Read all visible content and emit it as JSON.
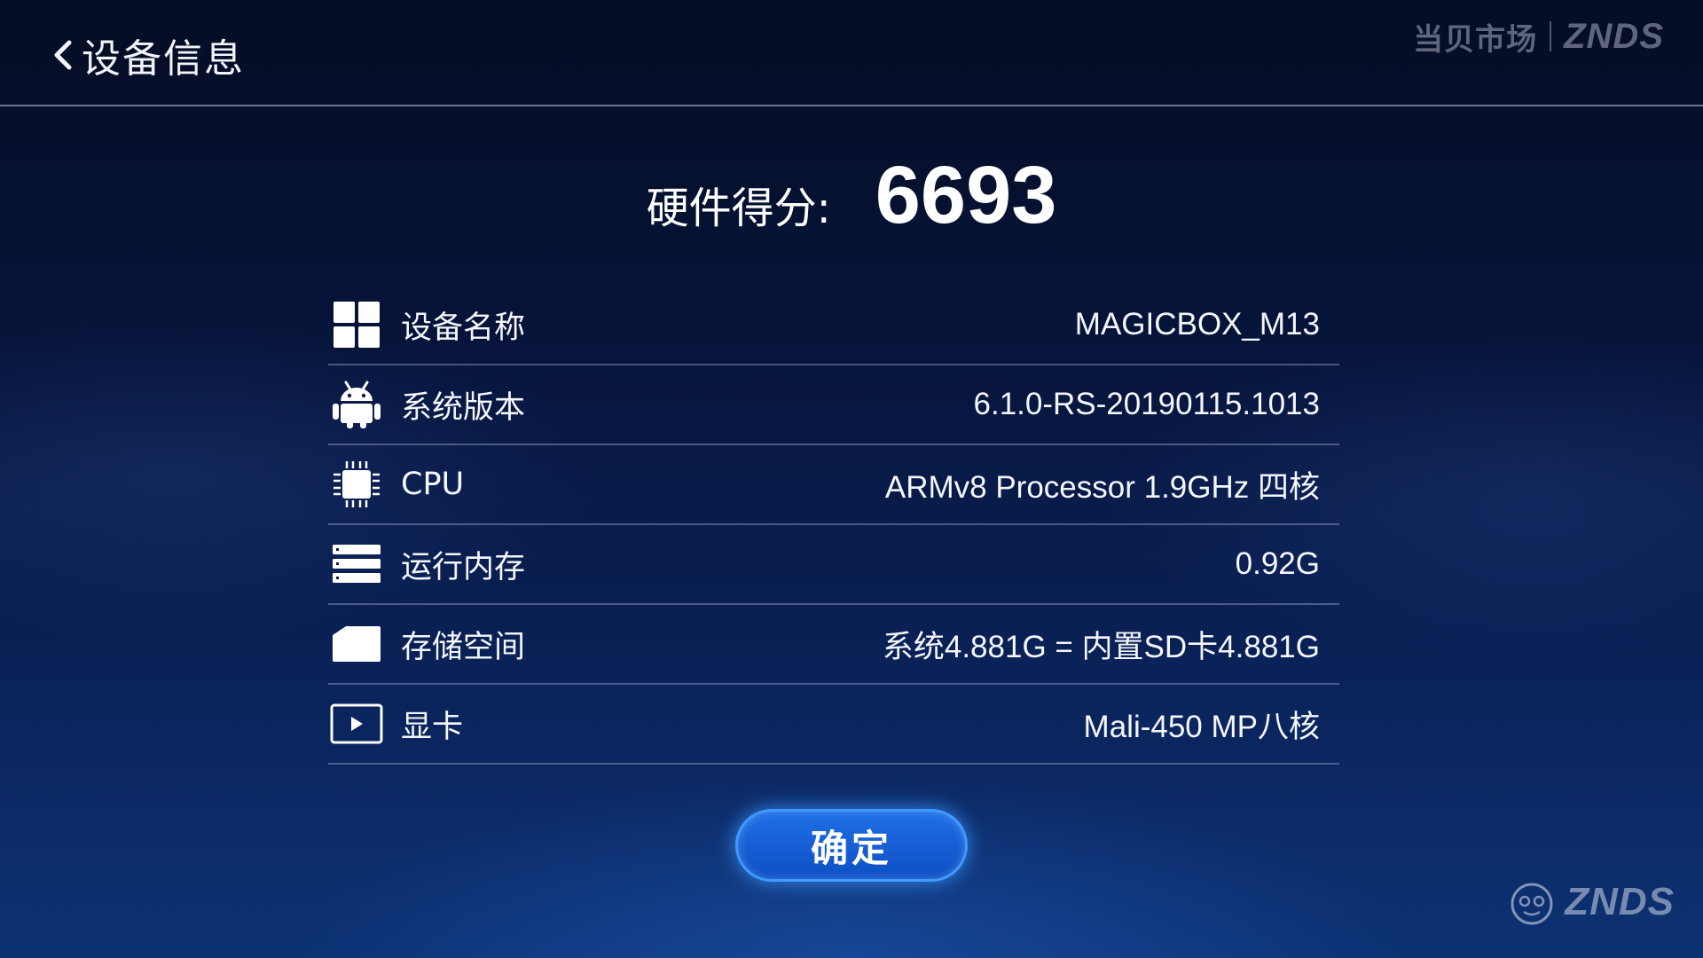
{
  "header": {
    "back_title": "设备信息",
    "brand_cn": "当贝市场",
    "brand_en": "ZNDS"
  },
  "score": {
    "label": "硬件得分:",
    "value": "6693"
  },
  "rows": [
    {
      "icon": "grid-icon",
      "label": "设备名称",
      "value": "MAGICBOX_M13"
    },
    {
      "icon": "android-icon",
      "label": "系统版本",
      "value": "6.1.0-RS-20190115.1013"
    },
    {
      "icon": "chip-icon",
      "label": "CPU",
      "value": "ARMv8 Processor  1.9GHz 四核"
    },
    {
      "icon": "memory-icon",
      "label": "运行内存",
      "value": "0.92G"
    },
    {
      "icon": "sd-card-icon",
      "label": "存储空间",
      "value": "系统4.881G = 内置SD卡4.881G"
    },
    {
      "icon": "play-icon",
      "label": "显卡",
      "value": "Mali-450 MP八核"
    }
  ],
  "confirm_label": "确定",
  "watermark": {
    "text": "ZNDS"
  },
  "colors": {
    "accent": "#1f6fe6",
    "button_border": "#3f9bff",
    "background_top": "#050d24",
    "background_bottom": "#0d3274"
  }
}
